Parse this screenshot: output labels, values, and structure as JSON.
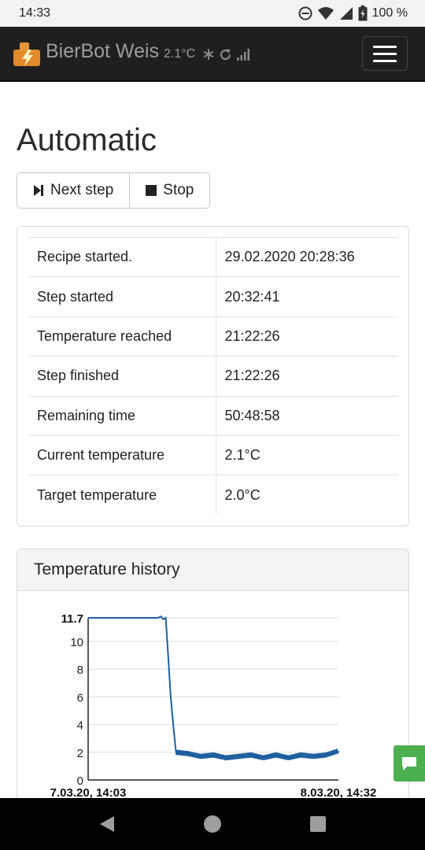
{
  "status_bar": {
    "time": "14:33",
    "battery": "100 %",
    "icons": [
      "dnd-icon",
      "wifi-icon",
      "signal-icon",
      "battery-icon"
    ]
  },
  "navbar": {
    "title": "BierBot Weis",
    "temperature": "2.1°C",
    "icons": [
      "logo-icon",
      "cooling-icon",
      "refresh-icon",
      "signal-bars-icon",
      "menu-icon"
    ]
  },
  "page": {
    "title": "Automatic"
  },
  "buttons": {
    "next_step": "Next step",
    "stop": "Stop"
  },
  "info_table": [
    {
      "label": "Recipe started.",
      "value": "29.02.2020 20:28:36"
    },
    {
      "label": "Step started",
      "value": "20:32:41"
    },
    {
      "label": "Temperature reached",
      "value": "21:22:26"
    },
    {
      "label": "Step finished",
      "value": "21:22:26"
    },
    {
      "label": "Remaining time",
      "value": "50:48:58"
    },
    {
      "label": "Current temperature",
      "value": "2.1°C"
    },
    {
      "label": "Target temperature",
      "value": "2.0°C"
    }
  ],
  "chart_card": {
    "title": "Temperature history"
  },
  "chart_data": {
    "type": "line",
    "title": "Temperature history",
    "xlabel": "",
    "ylabel": "",
    "x_tick_labels": [
      "7.03.20, 14:03",
      "8.03.20, 14:32"
    ],
    "y_ticks": [
      0,
      2,
      4,
      6,
      8,
      10
    ],
    "y_max_label": "11.7",
    "ylim": [
      0,
      11.7
    ],
    "grid": true,
    "line_color": "#1f5fa0",
    "series": [
      {
        "x": [
          0,
          0.28,
          0.29,
          0.3,
          0.31,
          0.33,
          0.35,
          0.4,
          0.45,
          0.5,
          0.55,
          0.6,
          0.65,
          0.7,
          0.75,
          0.8,
          0.85,
          0.9,
          0.95,
          1.0
        ],
        "y": [
          11.7,
          11.7,
          11.8,
          11.6,
          11.7,
          6.0,
          2.0,
          1.9,
          1.7,
          1.8,
          1.6,
          1.7,
          1.8,
          1.6,
          1.8,
          1.6,
          1.8,
          1.7,
          1.8,
          2.1
        ]
      }
    ]
  },
  "chat_button": {
    "icon": "chat-icon"
  },
  "android_nav": {
    "icons": [
      "back-icon",
      "home-icon",
      "recents-icon"
    ]
  }
}
